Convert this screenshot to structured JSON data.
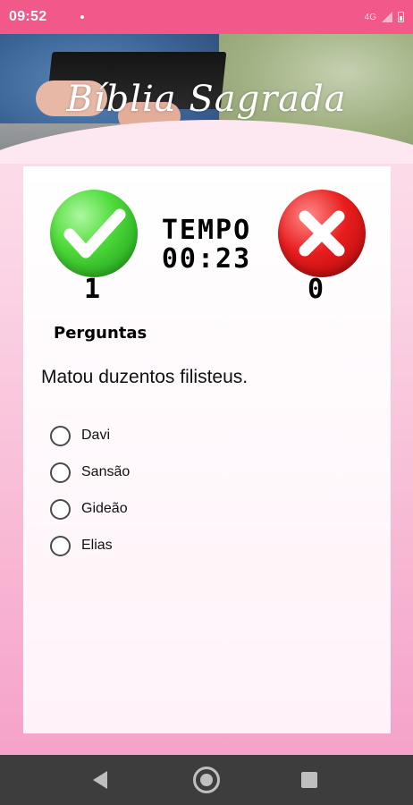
{
  "status_bar": {
    "time": "09:52",
    "network": "4G"
  },
  "header": {
    "title": "Bíblia Sagrada"
  },
  "quiz": {
    "timer_label": "TEMPO",
    "timer_value": "00:23",
    "correct_count": "1",
    "wrong_count": "0",
    "section_label": "Perguntas",
    "question": "Matou duzentos filisteus.",
    "options": [
      "Davi",
      "Sansão",
      "Gideão",
      "Elias"
    ]
  },
  "colors": {
    "status_bar": "#f2588a",
    "correct": "#2fbf2a",
    "wrong": "#e01818",
    "nav_bar": "#3d3d3d"
  },
  "icons": {
    "correct": "check-icon",
    "wrong": "x-icon",
    "nav_back": "back-triangle-icon",
    "nav_home": "home-circle-icon",
    "nav_recents": "recents-square-icon"
  }
}
